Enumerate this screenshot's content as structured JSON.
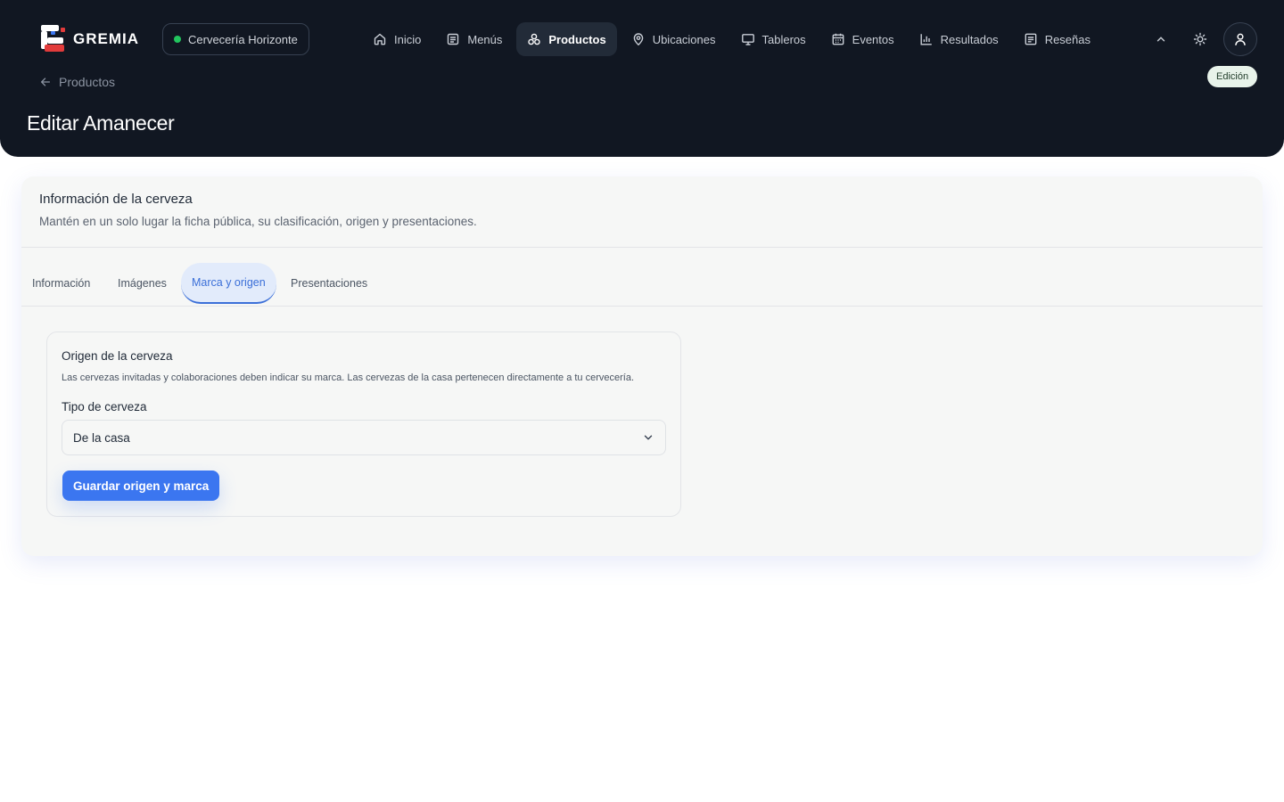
{
  "brand": {
    "logo_text": "GREMIA"
  },
  "brewery": {
    "name": "Cervecería Horizonte",
    "status_color": "#22c55e"
  },
  "nav": [
    {
      "label": "Inicio",
      "icon": "home-icon"
    },
    {
      "label": "Menús",
      "icon": "menu-list-icon"
    },
    {
      "label": "Productos",
      "icon": "products-icon",
      "active": true
    },
    {
      "label": "Ubicaciones",
      "icon": "location-pin-icon"
    },
    {
      "label": "Tableros",
      "icon": "monitor-icon"
    },
    {
      "label": "Eventos",
      "icon": "calendar-icon"
    },
    {
      "label": "Resultados",
      "icon": "bar-chart-icon"
    },
    {
      "label": "Reseñas",
      "icon": "review-icon"
    }
  ],
  "header": {
    "mode_badge": "Edición",
    "back_label": "Productos",
    "page_title": "Editar Amanecer"
  },
  "card": {
    "title": "Información de la cerveza",
    "subtitle": "Mantén en un solo lugar la ficha pública, su clasificación, origen y presentaciones."
  },
  "tabs": [
    {
      "label": "Información"
    },
    {
      "label": "Imágenes"
    },
    {
      "label": "Marca y origen",
      "active": true
    },
    {
      "label": "Presentaciones"
    }
  ],
  "origin": {
    "title": "Origen de la cerveza",
    "description": "Las cervezas invitadas y colaboraciones deben indicar su marca. Las cervezas de la casa pertenecen directamente a tu cervecería.",
    "field_label": "Tipo de cerveza",
    "selected": "De la casa",
    "save_label": "Guardar origen y marca"
  },
  "colors": {
    "header_bg": "#111722",
    "accent": "#3b76f0",
    "active_tab_bg": "#e2ebfb",
    "badge_bg": "#e8f3ea"
  }
}
